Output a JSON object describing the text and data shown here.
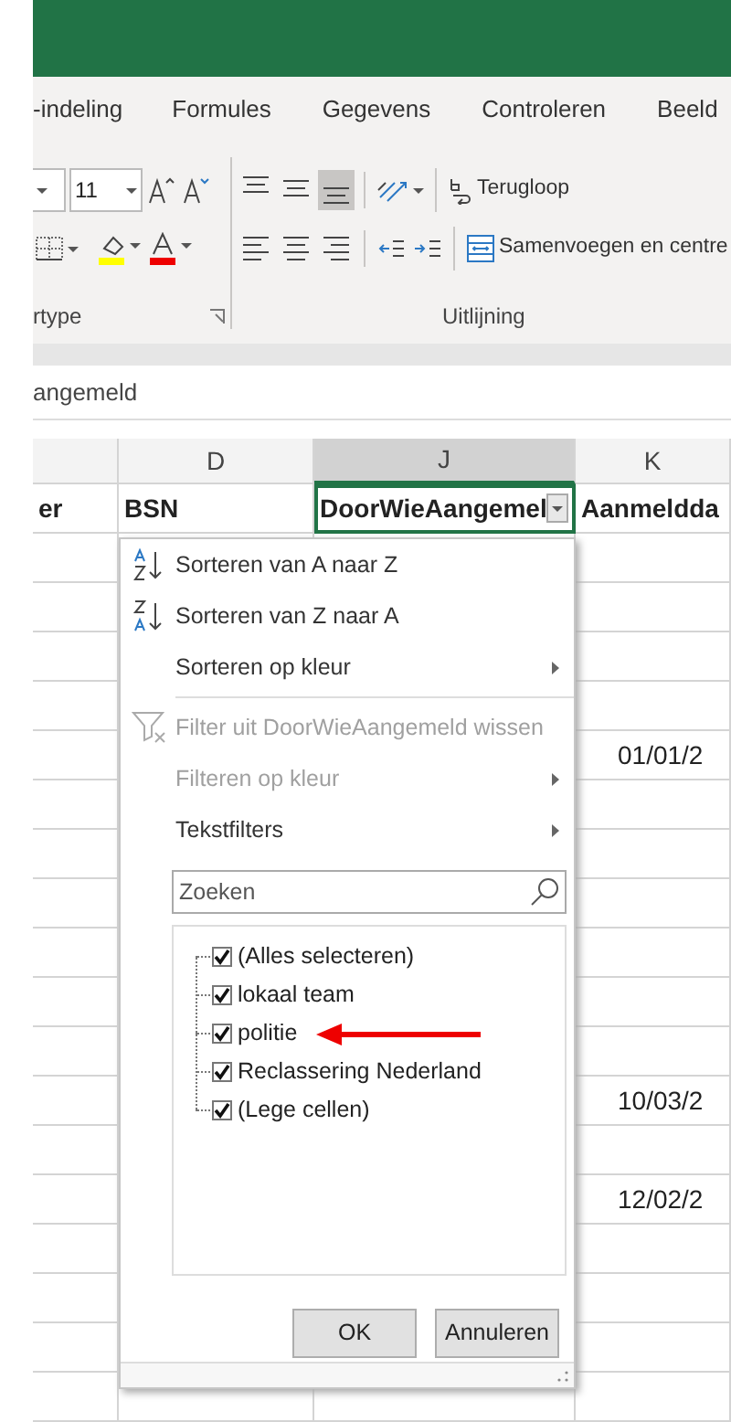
{
  "ribbon_tabs": [
    {
      "label": "-indeling"
    },
    {
      "label": "Formules"
    },
    {
      "label": "Gegevens"
    },
    {
      "label": "Controleren"
    },
    {
      "label": "Beeld"
    }
  ],
  "font_group": {
    "label": "rtype",
    "font_size": "11"
  },
  "alignment_group": {
    "label": "Uitlijning",
    "wrap_text": "Terugloop",
    "merge": "Samenvoegen en centre",
    "vertical_align": [
      {
        "kind": "top",
        "selected": false
      },
      {
        "kind": "middle",
        "selected": false
      },
      {
        "kind": "bottom",
        "selected": true
      }
    ]
  },
  "formula_bar": {
    "value": "angemeld"
  },
  "sheet": {
    "columns": [
      {
        "selected": false
      },
      {
        "label": "D",
        "selected": false
      },
      {
        "label": "J",
        "selected": true
      },
      {
        "label": "K",
        "selected": false
      }
    ],
    "header_row": [
      "er",
      "BSN",
      "DoorWieAangemel",
      "Aanmeldda"
    ],
    "rows": [
      {},
      {},
      {},
      {},
      {
        "column_k": "01/01/2"
      },
      {},
      {},
      {},
      {},
      {},
      {},
      {
        "column_k": "10/03/2"
      },
      {},
      {
        "column_k": "12/02/2"
      },
      {},
      {},
      {},
      {}
    ]
  },
  "filter_menu": {
    "items": [
      {
        "kind": "sort-asc",
        "label": "Sorteren van A naar Z",
        "disabled": false,
        "submenu": false
      },
      {
        "kind": "sort-desc",
        "label": "Sorteren van Z naar A",
        "disabled": false,
        "submenu": false
      },
      {
        "kind": "item",
        "label": "Sorteren op kleur",
        "disabled": false,
        "submenu": true
      },
      {
        "kind": "separator"
      },
      {
        "kind": "clear-filter",
        "label": "Filter uit DoorWieAangemeld wissen",
        "disabled": true,
        "submenu": false
      },
      {
        "kind": "item",
        "label": "Filteren op kleur",
        "disabled": true,
        "submenu": true
      },
      {
        "kind": "item",
        "label": "Tekstfilters",
        "disabled": false,
        "submenu": true
      }
    ],
    "search": {
      "placeholder": "Zoeken"
    },
    "values": [
      {
        "label": "(Alles selecteren)",
        "checked": true,
        "annotated": false
      },
      {
        "label": "lokaal team",
        "checked": true,
        "annotated": false
      },
      {
        "label": "politie",
        "checked": true,
        "annotated": true
      },
      {
        "label": "Reclassering Nederland",
        "checked": true,
        "annotated": false
      },
      {
        "label": "(Lege cellen)",
        "checked": true,
        "annotated": false
      }
    ],
    "buttons": [
      "OK",
      "Annuleren"
    ]
  }
}
